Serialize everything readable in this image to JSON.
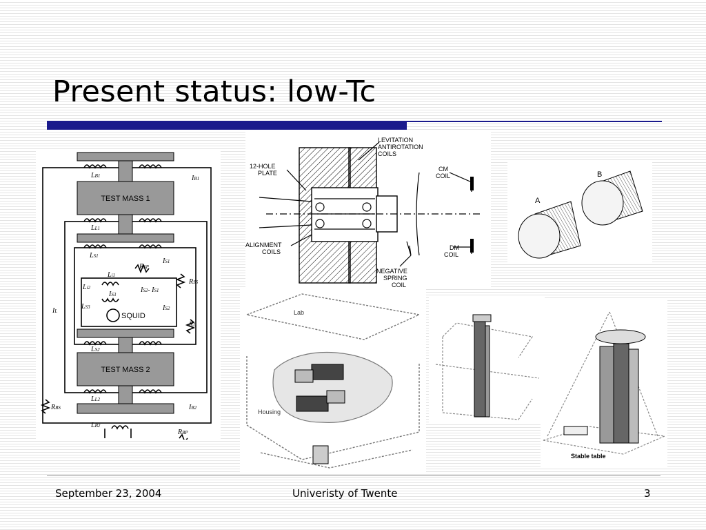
{
  "slide": {
    "title": "Present status: low-Tc"
  },
  "circuit": {
    "test_mass_1": "TEST MASS 1",
    "test_mass_2": "TEST MASS 2",
    "squid": "SQUID",
    "symbols": [
      "L",
      "B1",
      "I",
      "B1",
      "L",
      "L1",
      "L",
      "S1",
      "R",
      "SP",
      "I",
      "S1",
      "R",
      "SS",
      "L",
      "i1",
      "L",
      "i2",
      "I",
      "S3",
      "I",
      "S2",
      "- I",
      "S1",
      "L",
      "S3",
      "I",
      "S2",
      "I",
      "L",
      "R",
      "L",
      "L",
      "S2",
      "L",
      "L2",
      "R",
      "BS",
      "I",
      "B2",
      "L",
      "B2",
      "R",
      "BP"
    ]
  },
  "levitation": {
    "labels": [
      "LEVITATION",
      "ANTIROTATION",
      "COILS",
      "12-HOLE",
      "PLATE",
      "CM",
      "COIL",
      "ALIGNMENT",
      "COILS",
      "DM",
      "COIL",
      "NEGATIVE",
      "SPRING",
      "COIL"
    ]
  },
  "cylinders": {
    "label_a": "A",
    "label_b": "B"
  },
  "housing": {
    "labels": [
      "Lab",
      "Housing"
    ]
  },
  "stable_table": {
    "label": "Stable table"
  },
  "footer": {
    "date": "September 23, 2004",
    "organization": "Univeristy of Twente",
    "page": "3"
  }
}
